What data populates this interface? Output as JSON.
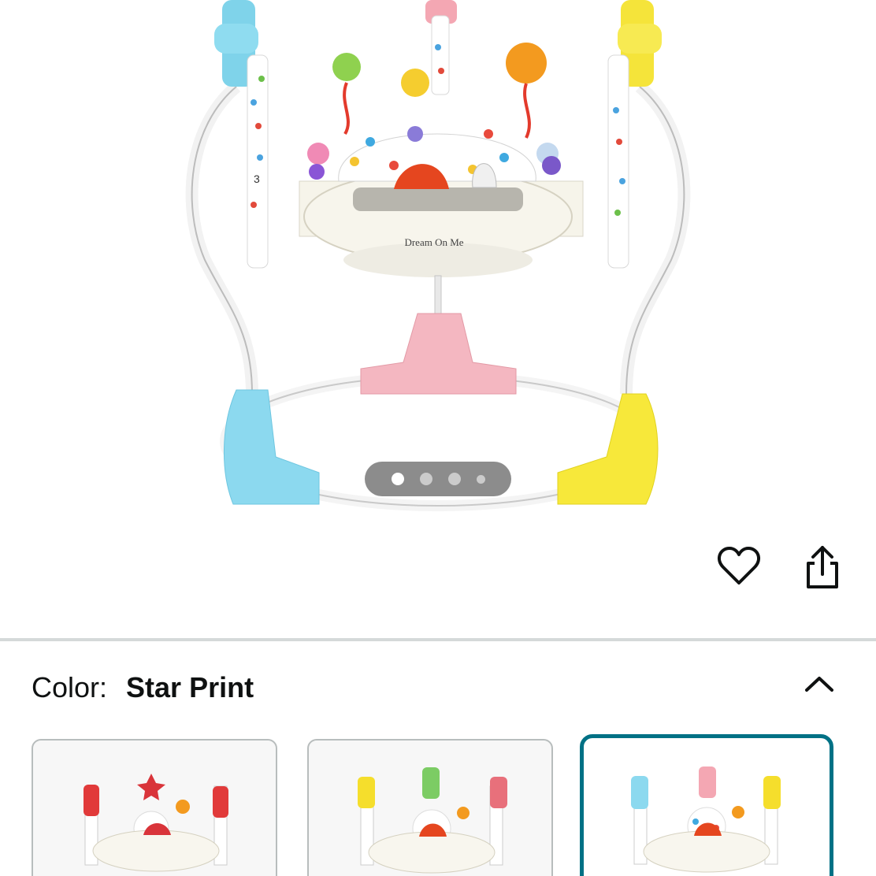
{
  "product": {
    "brand_mark": "Dream On Me",
    "seat_number_left": "3",
    "image_count": 4,
    "active_image_index": 0
  },
  "actions": {
    "favorite_icon": "heart-icon",
    "share_icon": "share-icon"
  },
  "variation": {
    "label": "Color:",
    "selected_value": "Star Print",
    "collapse_icon": "chevron-up-icon",
    "options": [
      {
        "name": "red-variant",
        "selected": false
      },
      {
        "name": "multicolor-variant",
        "selected": false
      },
      {
        "name": "star-print-variant",
        "selected": true
      }
    ]
  },
  "colors": {
    "selected_border": "#007185",
    "divider": "#d5d9d9"
  }
}
